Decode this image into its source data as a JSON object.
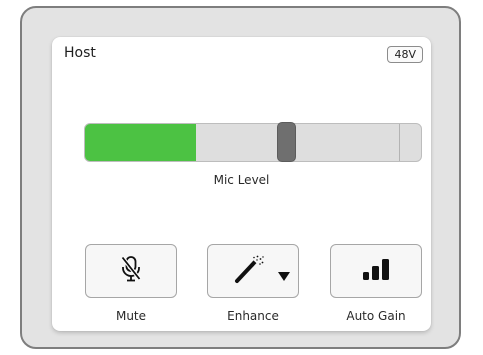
{
  "channel": {
    "title": "Host",
    "phantom_power_label": "48V"
  },
  "mic_level": {
    "label": "Mic Level",
    "meter_level_fraction": 0.33,
    "peak_fraction": 0.935,
    "fader_fraction": 0.6,
    "meter_color": "#4cc243"
  },
  "buttons": {
    "mute": {
      "label": "Mute",
      "icon": "mic-muted-icon"
    },
    "enhance": {
      "label": "Enhance",
      "icon": "magic-wand-icon",
      "dropdown_icon": "caret-down-icon"
    },
    "auto_gain": {
      "label": "Auto Gain",
      "icon": "level-bars-icon"
    }
  }
}
